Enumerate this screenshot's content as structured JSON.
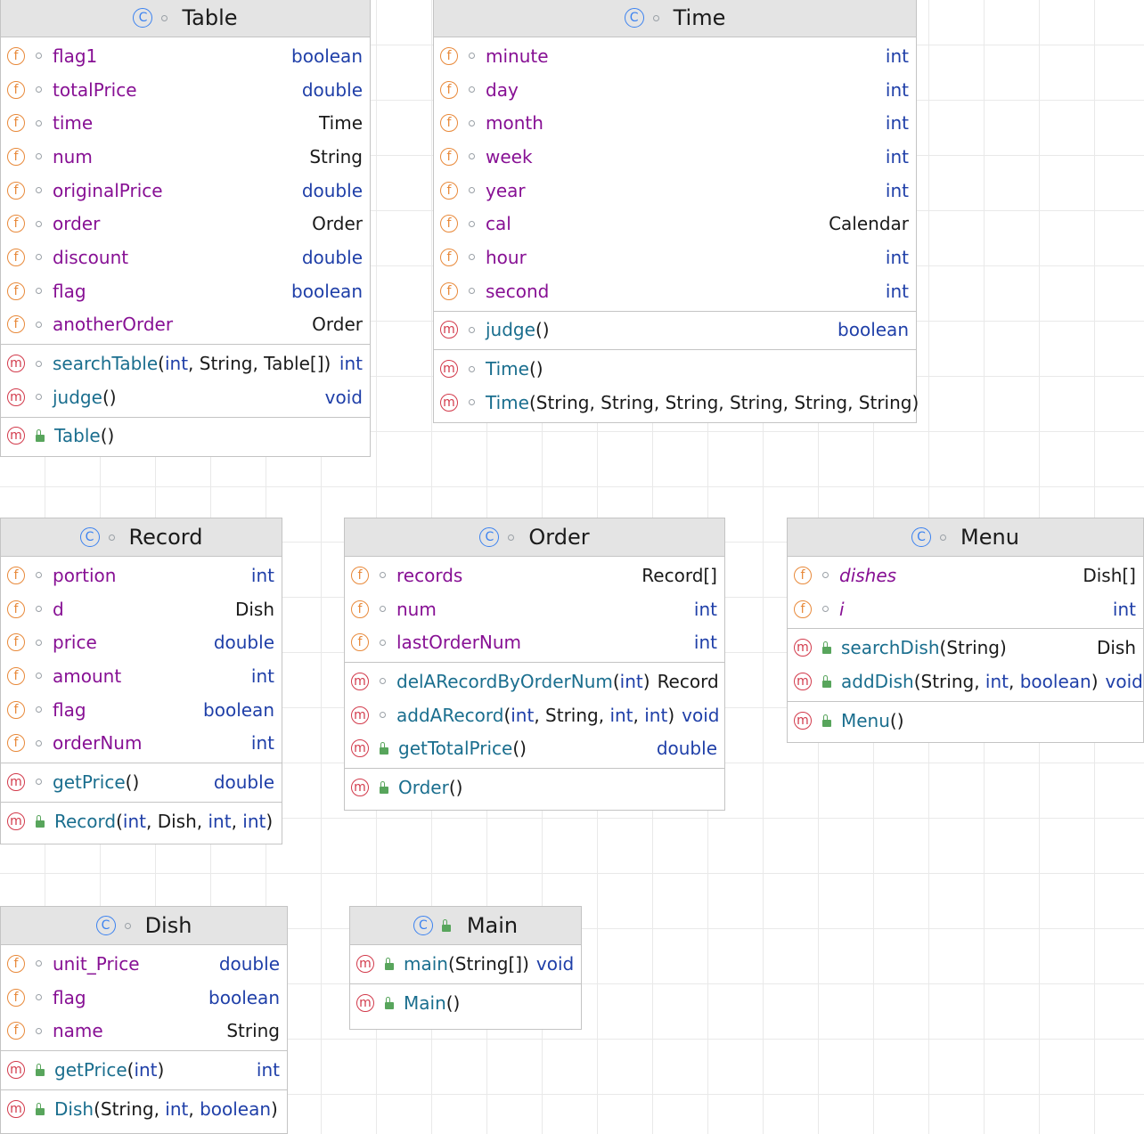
{
  "icons": {
    "class": "class-icon",
    "field": "field-icon",
    "method": "method-icon",
    "package_private": "package-private-visibility-icon",
    "public": "public-lock-icon"
  },
  "badges": {
    "class": "C",
    "field": "f",
    "method": "m"
  },
  "colors": {
    "field_badge": "#e8893a",
    "method_badge": "#d23a4b",
    "class_badge": "#3b82f0",
    "field_name": "#871094",
    "method_name": "#1a6e8e",
    "primitive_type": "#1f3fa8",
    "public_visibility": "#58a55c",
    "header_bg": "#e4e4e4"
  },
  "table": {
    "name": "Table",
    "fields": [
      {
        "name": "flag1",
        "type": "boolean"
      },
      {
        "name": "totalPrice",
        "type": "double"
      },
      {
        "name": "time",
        "type": "Time"
      },
      {
        "name": "num",
        "type": "String"
      },
      {
        "name": "originalPrice",
        "type": "double"
      },
      {
        "name": "order",
        "type": "Order"
      },
      {
        "name": "discount",
        "type": "double"
      },
      {
        "name": "flag",
        "type": "boolean"
      },
      {
        "name": "anotherOrder",
        "type": "Order"
      }
    ],
    "methods": [
      {
        "name": "searchTable",
        "params": [
          "int",
          "String",
          "Table[]"
        ],
        "type": "int"
      },
      {
        "name": "judge",
        "params": [],
        "type": "void"
      }
    ],
    "constructors": [
      {
        "name": "Table",
        "params": []
      }
    ]
  },
  "time": {
    "name": "Time",
    "fields": [
      {
        "name": "minute",
        "type": "int"
      },
      {
        "name": "day",
        "type": "int"
      },
      {
        "name": "month",
        "type": "int"
      },
      {
        "name": "week",
        "type": "int"
      },
      {
        "name": "year",
        "type": "int"
      },
      {
        "name": "cal",
        "type": "Calendar"
      },
      {
        "name": "hour",
        "type": "int"
      },
      {
        "name": "second",
        "type": "int"
      }
    ],
    "methods": [
      {
        "name": "judge",
        "params": [],
        "type": "boolean"
      }
    ],
    "constructors": [
      {
        "name": "Time",
        "params": []
      },
      {
        "name": "Time",
        "params": [
          "String",
          "String",
          "String",
          "String",
          "String",
          "String"
        ]
      }
    ]
  },
  "record": {
    "name": "Record",
    "fields": [
      {
        "name": "portion",
        "type": "int"
      },
      {
        "name": "d",
        "type": "Dish"
      },
      {
        "name": "price",
        "type": "double"
      },
      {
        "name": "amount",
        "type": "int"
      },
      {
        "name": "flag",
        "type": "boolean"
      },
      {
        "name": "orderNum",
        "type": "int"
      }
    ],
    "methods": [
      {
        "name": "getPrice",
        "params": [],
        "type": "double"
      }
    ],
    "constructors": [
      {
        "name": "Record",
        "params": [
          "int",
          "Dish",
          "int",
          "int"
        ]
      }
    ]
  },
  "order": {
    "name": "Order",
    "fields": [
      {
        "name": "records",
        "type": "Record[]"
      },
      {
        "name": "num",
        "type": "int"
      },
      {
        "name": "lastOrderNum",
        "type": "int"
      }
    ],
    "methods": [
      {
        "name": "delARecordByOrderNum",
        "params": [
          "int"
        ],
        "type": "Record"
      },
      {
        "name": "addARecord",
        "params": [
          "int",
          "String",
          "int",
          "int"
        ],
        "type": "void"
      },
      {
        "name": "getTotalPrice",
        "params": [],
        "type": "double"
      }
    ],
    "constructors": [
      {
        "name": "Order",
        "params": []
      }
    ]
  },
  "menu": {
    "name": "Menu",
    "fields": [
      {
        "name": "dishes",
        "type": "Dish[]"
      },
      {
        "name": "i",
        "type": "int"
      }
    ],
    "methods": [
      {
        "name": "searchDish",
        "params": [
          "String"
        ],
        "type": "Dish"
      },
      {
        "name": "addDish",
        "params": [
          "String",
          "int",
          "boolean"
        ],
        "type": "void"
      }
    ],
    "constructors": [
      {
        "name": "Menu",
        "params": []
      }
    ]
  },
  "dish": {
    "name": "Dish",
    "fields": [
      {
        "name": "unit_Price",
        "type": "double"
      },
      {
        "name": "flag",
        "type": "boolean"
      },
      {
        "name": "name",
        "type": "String"
      }
    ],
    "methods": [
      {
        "name": "getPrice",
        "params": [
          "int"
        ],
        "type": "int"
      }
    ],
    "constructors": [
      {
        "name": "Dish",
        "params": [
          "String",
          "int",
          "boolean"
        ]
      }
    ]
  },
  "main": {
    "name": "Main",
    "fields": [],
    "methods": [
      {
        "name": "main",
        "params": [
          "String[]"
        ],
        "type": "void"
      }
    ],
    "constructors": [
      {
        "name": "Main",
        "params": []
      }
    ]
  }
}
